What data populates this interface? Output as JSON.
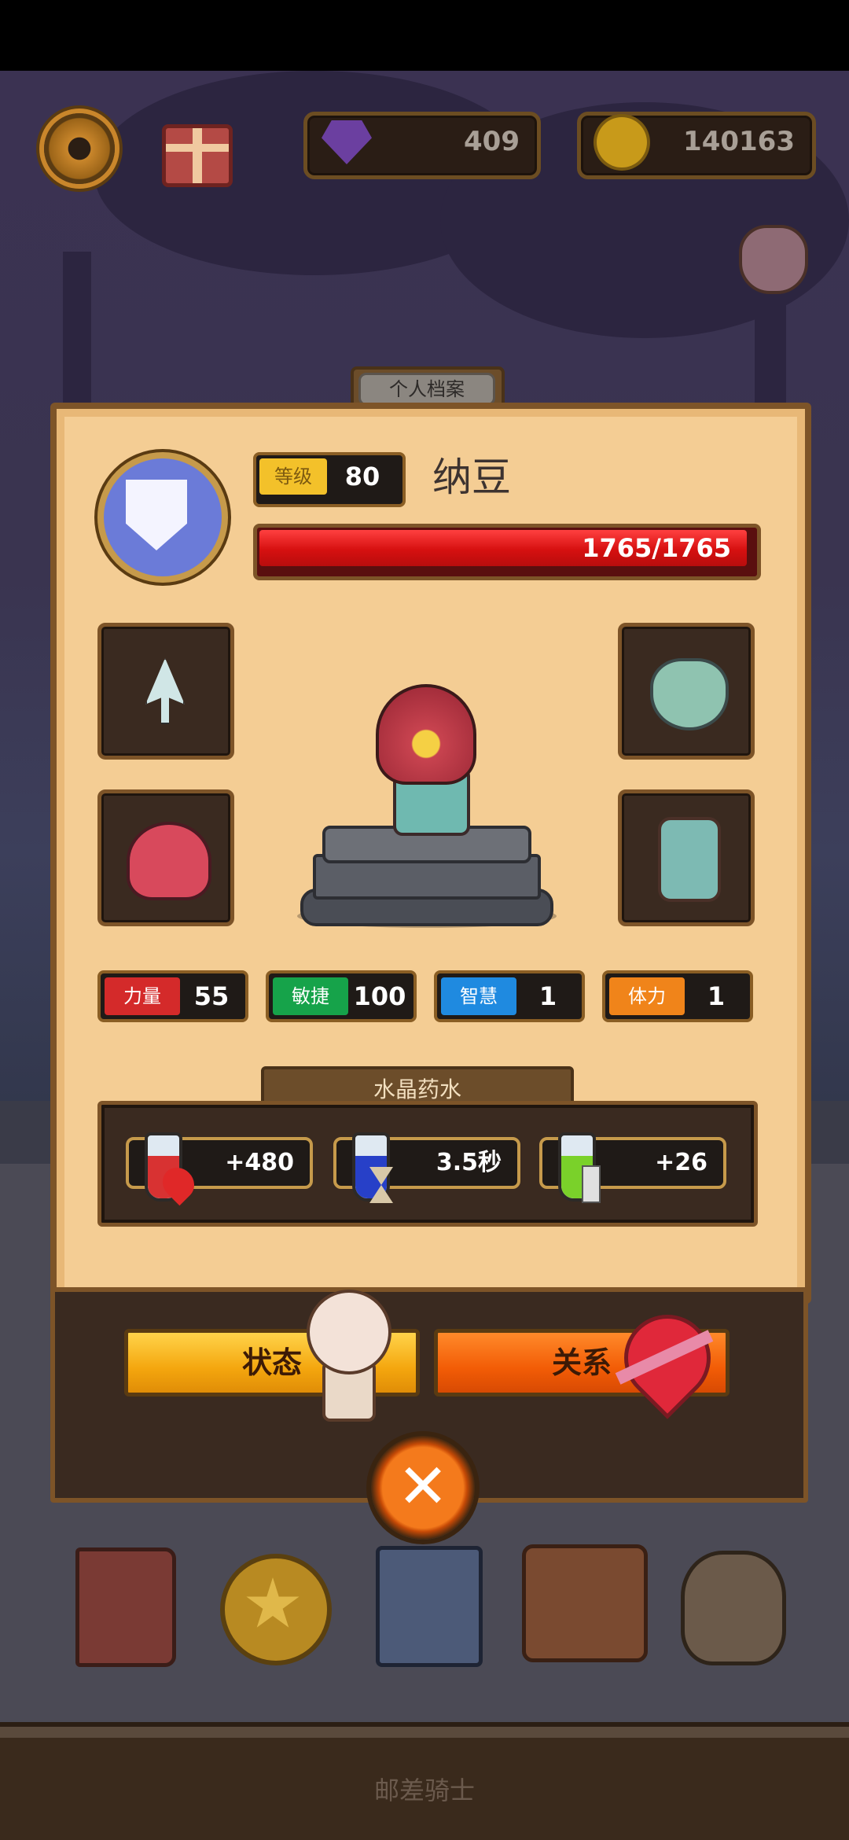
{
  "hud": {
    "gems": "409",
    "coins": "140163",
    "icons": [
      "gear-icon",
      "gift-icon",
      "gem-icon",
      "coin-icon",
      "loot-bag-icon"
    ]
  },
  "panel": {
    "tab_title": "个人档案",
    "level_label": "等级",
    "level_value": "80",
    "player_name": "纳豆",
    "hp_text": "1765/1765",
    "hp_fraction": 1.0,
    "equipment": [
      "weapon-slot",
      "armor-slot",
      "helmet-slot",
      "clothing-slot"
    ]
  },
  "stats": [
    {
      "label": "力量",
      "value": "55",
      "color": "#d42a2a"
    },
    {
      "label": "敏捷",
      "value": "100",
      "color": "#16a34a"
    },
    {
      "label": "智慧",
      "value": "1",
      "color": "#1f8ae0"
    },
    {
      "label": "体力",
      "value": "1",
      "color": "#f0841a"
    }
  ],
  "potions": {
    "section_title": "水晶药水",
    "items": [
      {
        "value": "+480",
        "liquid": "#d83232"
      },
      {
        "value": "3.5秒",
        "liquid": "#2740c8"
      },
      {
        "value": "+26",
        "liquid": "#7ad12a"
      }
    ]
  },
  "actions": {
    "status_label": "状态",
    "relation_label": "关系",
    "close_symbol": "✕"
  },
  "footer": {
    "title": "邮差骑士"
  }
}
